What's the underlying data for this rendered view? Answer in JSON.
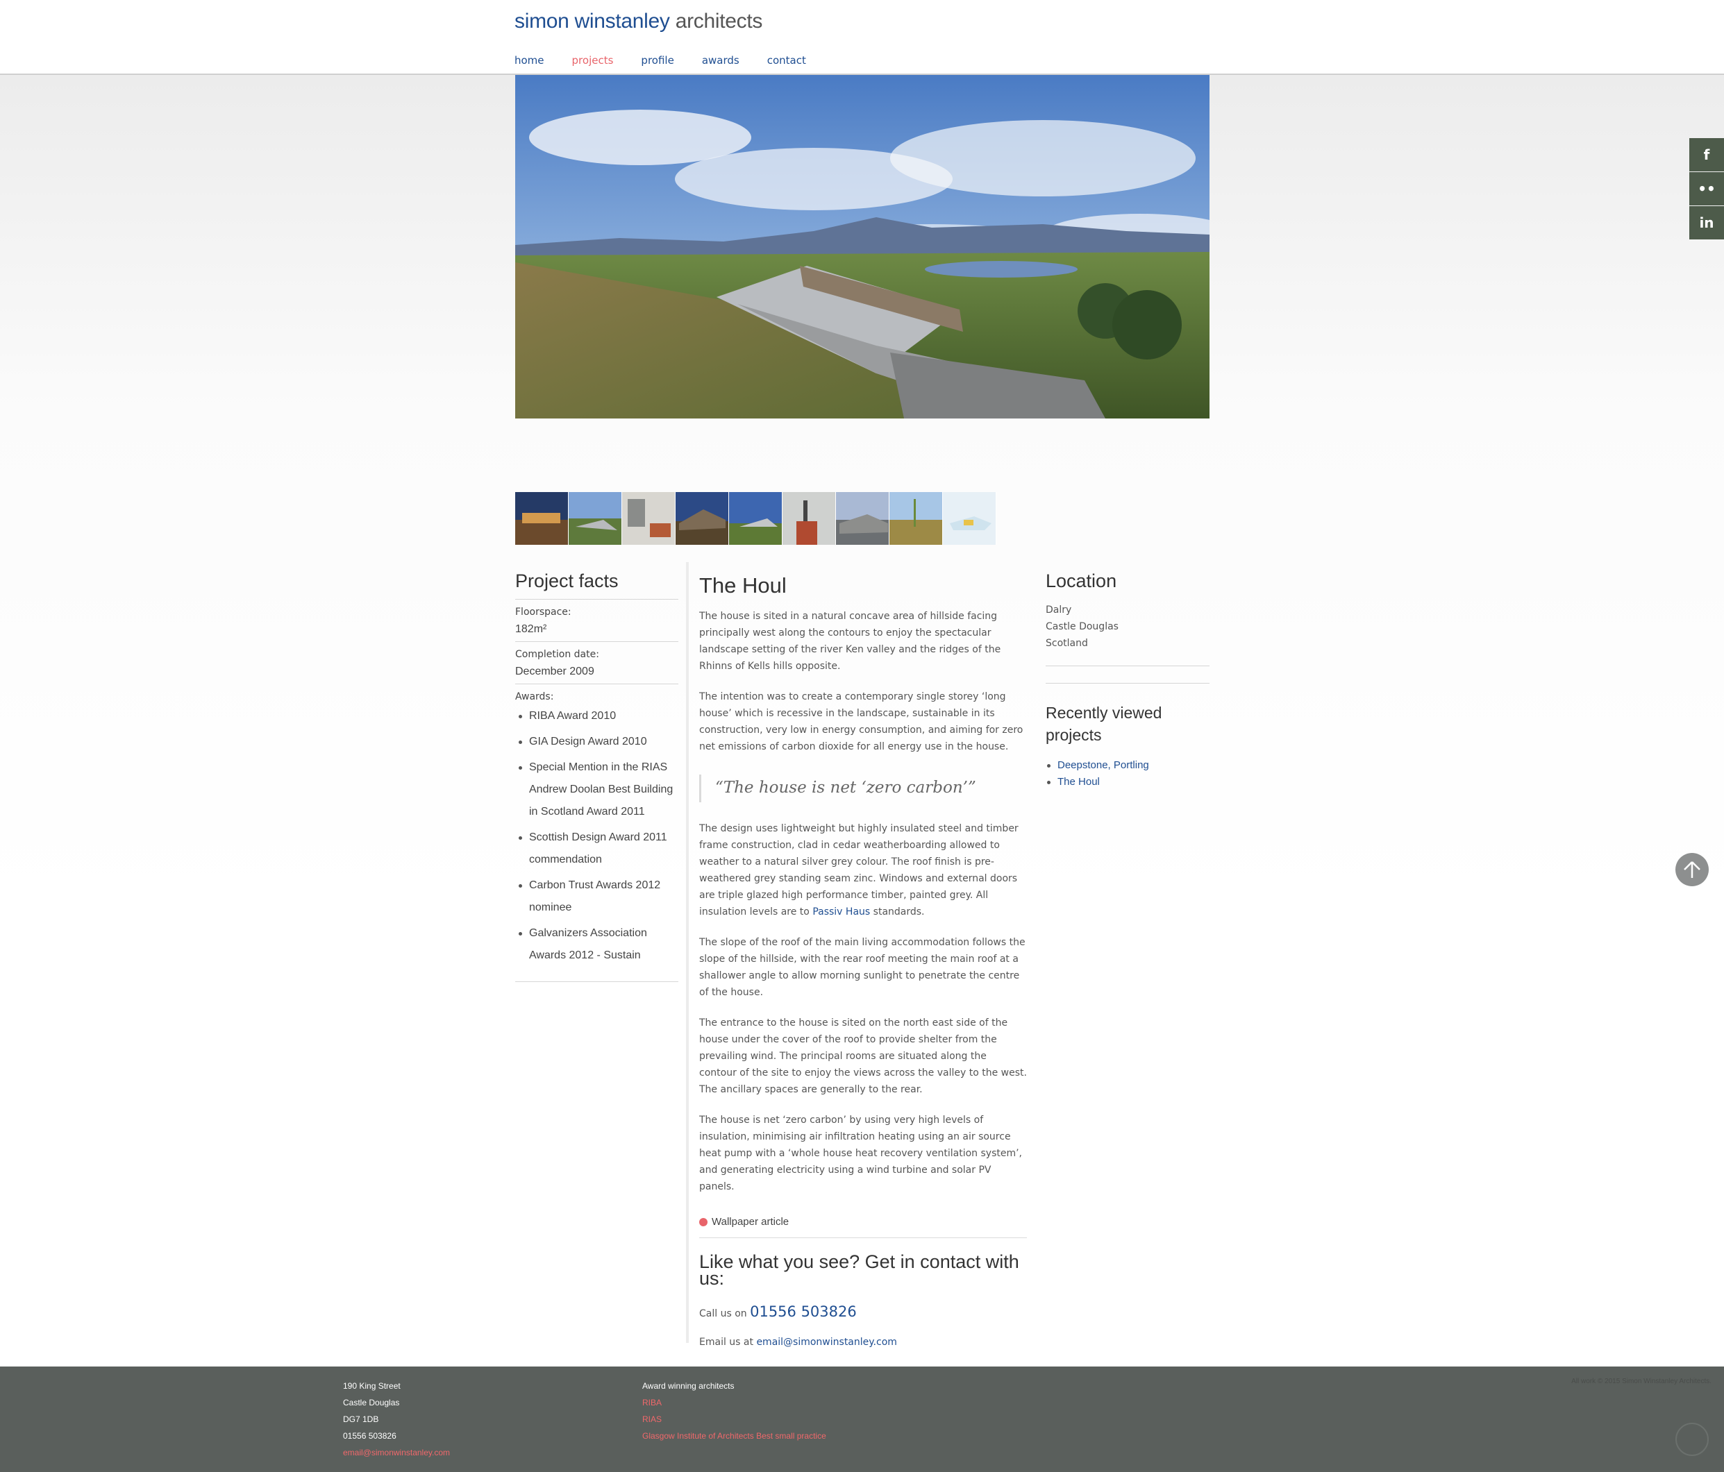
{
  "brand": {
    "name_first": "simon winstanley",
    "name_second": "architects"
  },
  "nav": [
    {
      "label": "home",
      "active": false
    },
    {
      "label": "projects",
      "active": true
    },
    {
      "label": "profile",
      "active": false
    },
    {
      "label": "awards",
      "active": false
    },
    {
      "label": "contact",
      "active": false
    }
  ],
  "social": [
    {
      "icon": "facebook-icon",
      "glyph": "f"
    },
    {
      "icon": "flickr-icon",
      "glyph": "••"
    },
    {
      "icon": "linkedin-icon",
      "glyph": "in"
    }
  ],
  "facts": {
    "title": "Project facts",
    "floorspace_label": "Floorspace:",
    "floorspace_value": "182m²",
    "completion_label": "Completion date:",
    "completion_value": "December 2009",
    "awards_label": "Awards:",
    "awards": [
      "RIBA Award 2010",
      "GIA Design Award 2010",
      "Special Mention in the RIAS Andrew Doolan Best Building in Scotland Award 2011",
      "Scottish Design Award 2011 commendation",
      "Carbon Trust Awards 2012 nominee",
      "Galvanizers Association Awards 2012 - Sustain"
    ]
  },
  "project": {
    "title": "The Houl",
    "p1": "The house is sited in a natural concave area of hillside facing principally west along the contours to enjoy the spectacular landscape setting of the river Ken valley and the ridges of the Rhinns of Kells hills opposite.",
    "p2": "The intention was to create a contemporary single storey ‘long house’ which is recessive in the landscape, sustainable in its construction, very low in energy consumption, and aiming for zero net emissions of carbon dioxide for all energy use in the house.",
    "quote": "“The house is net ‘zero carbon’”",
    "p3_before_link": "The design uses lightweight but highly insulated steel and timber frame construction, clad in cedar weatherboarding allowed to weather to a natural silver grey colour. The roof finish is pre-weathered grey standing seam zinc. Windows and external doors are triple glazed high performance timber, painted grey. All insulation levels are to",
    "p3_link": "Passiv Haus",
    "p3_after_link": "standards.",
    "p4": "The slope of the roof of the main living accommodation follows the slope of the hillside, with the rear roof meeting the main roof at a shallower angle to allow morning sunlight to penetrate the centre of the house.",
    "p5": "The entrance to the house is sited on the north east side of the house under the cover of the roof to provide shelter from the prevailing wind. The principal rooms are situated along the contour of the site to enjoy the views across the valley to the west. The ancillary spaces are generally to the rear.",
    "p6": "The house is net ‘zero carbon’ by using very high levels of insulation, minimising air infiltration heating using an air source heat pump with a ‘whole house heat recovery ventilation system’, and generating electricity using a wind turbine and solar PV panels.",
    "wallpaper_link": "Wallpaper article",
    "cta": "Like what you see? Get in contact with us:",
    "call_prefix": "Call us on",
    "phone": "01556 503826",
    "email_prefix": "Email us at",
    "email": "email@simonwinstanley.com"
  },
  "location": {
    "title": "Location",
    "lines": [
      "Dalry",
      "Castle Douglas",
      "Scotland"
    ]
  },
  "recent": {
    "title": "Recently viewed projects",
    "items": [
      "Deepstone, Portling",
      "The Houl"
    ]
  },
  "footer": {
    "address": [
      "190 King Street",
      "Castle Douglas",
      "DG7 1DB",
      "01556 503826"
    ],
    "email": "email@simonwinstanley.com",
    "heading": "Award winning architects",
    "links": [
      "RIBA",
      "RIAS",
      "Glasgow Institute of Architects Best small practice"
    ],
    "copyright": "All work © 2015 Simon Winstanley Architects."
  },
  "colors": {
    "accent": "#e8646a",
    "link": "#1f4e91",
    "social_bg": "#4d5b4a",
    "footer_bg": "#5a5f5c"
  }
}
